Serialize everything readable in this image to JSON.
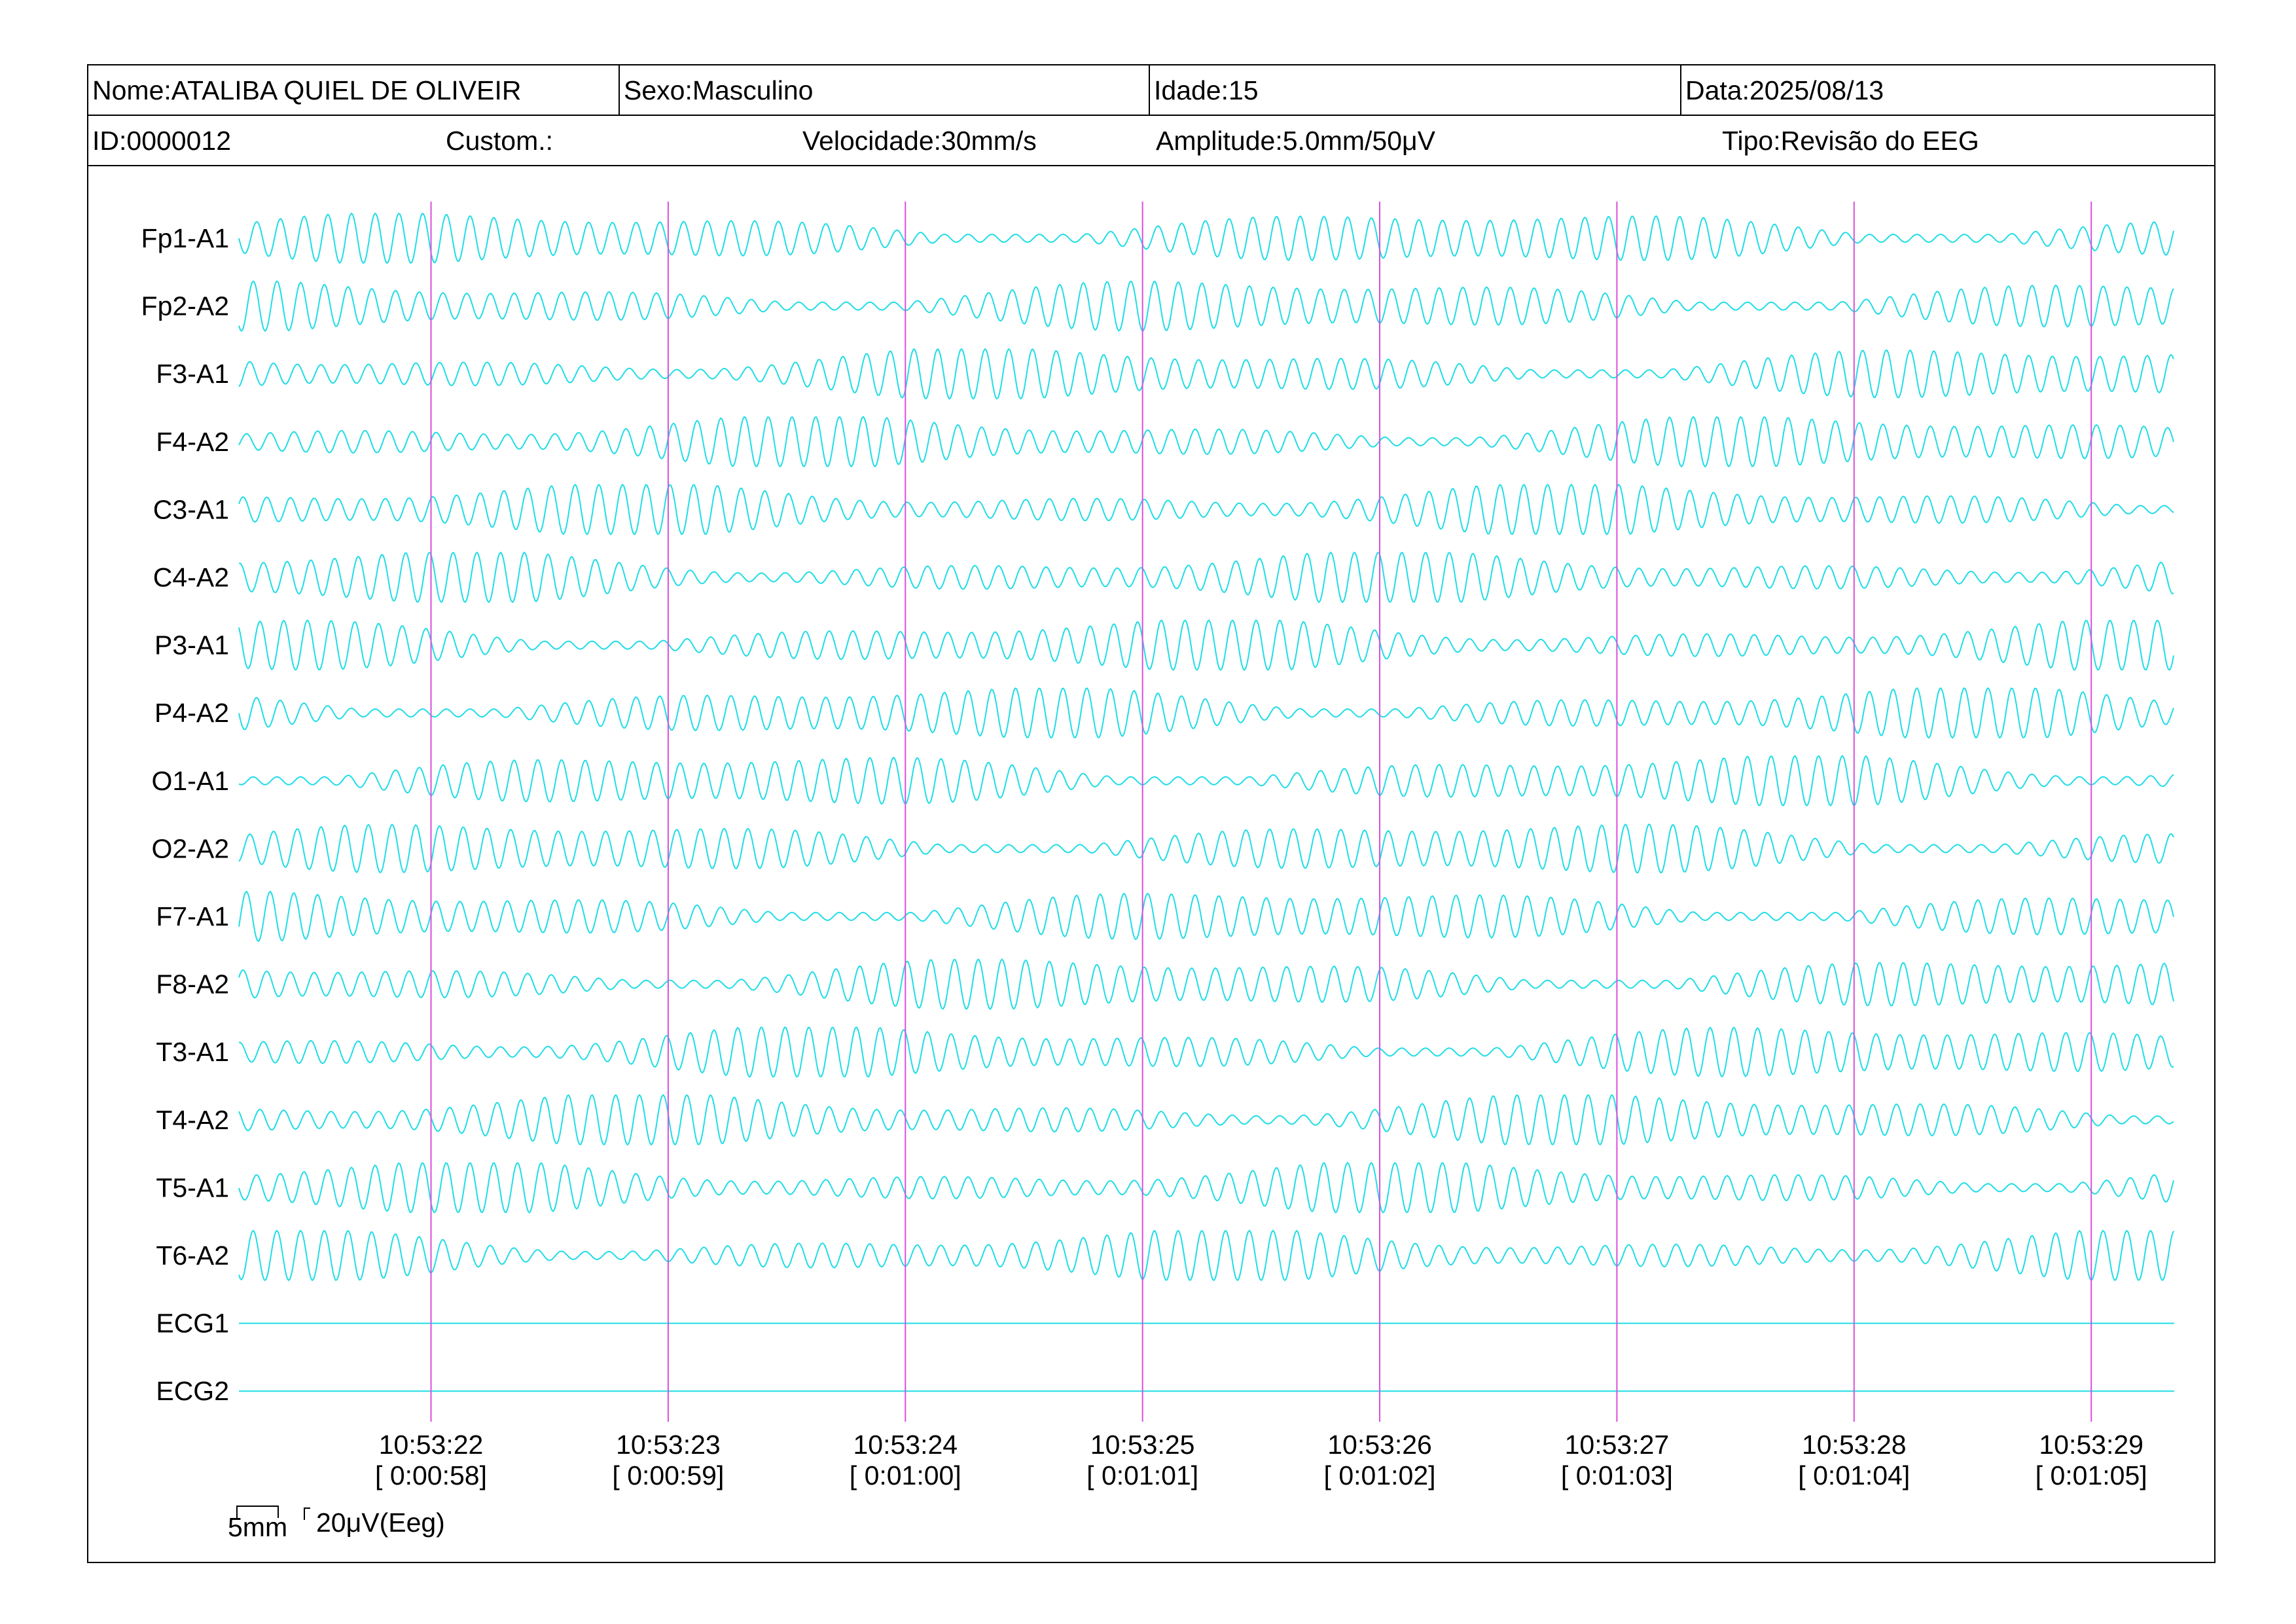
{
  "header": {
    "nome": "Nome:ATALIBA QUIEL DE OLIVEIR",
    "sexo": "Sexo:Masculino",
    "idade": "Idade:15",
    "data": "Data:2025/08/13",
    "id": "ID:0000012",
    "custom": "Custom.:",
    "velocidade": "Velocidade:30mm/s",
    "amplitude": "Amplitude:5.0mm/50μV",
    "tipo": "Tipo:Revisão do EEG"
  },
  "colors": {
    "trace": "#1fdde6",
    "marker": "#d94fd9",
    "frame": "#000000"
  },
  "chart_data": {
    "type": "line",
    "channels": [
      "Fp1-A1",
      "Fp2-A2",
      "F3-A1",
      "F4-A2",
      "C3-A1",
      "C4-A2",
      "P3-A1",
      "P4-A2",
      "O1-A1",
      "O2-A2",
      "F7-A1",
      "F8-A2",
      "T3-A1",
      "T4-A2",
      "T5-A1",
      "T6-A2",
      "ECG1",
      "ECG2"
    ],
    "flat_channels": [
      "ECG1",
      "ECG2"
    ],
    "time_markers": [
      {
        "clock": "10:53:22",
        "elapsed": "[ 0:00:58]"
      },
      {
        "clock": "10:53:23",
        "elapsed": "[ 0:00:59]"
      },
      {
        "clock": "10:53:24",
        "elapsed": "[ 0:01:00]"
      },
      {
        "clock": "10:53:25",
        "elapsed": "[ 0:01:01]"
      },
      {
        "clock": "10:53:26",
        "elapsed": "[ 0:01:02]"
      },
      {
        "clock": "10:53:27",
        "elapsed": "[ 0:01:03]"
      },
      {
        "clock": "10:53:28",
        "elapsed": "[ 0:01:04]"
      },
      {
        "clock": "10:53:29",
        "elapsed": "[ 0:01:05]"
      }
    ],
    "time_start_s": 57.19,
    "time_end_s": 65.35,
    "wave_frequency_hz": 10,
    "scale_bar": {
      "time_label": "5mm",
      "amplitude_label": "20μV(Eeg)"
    }
  }
}
